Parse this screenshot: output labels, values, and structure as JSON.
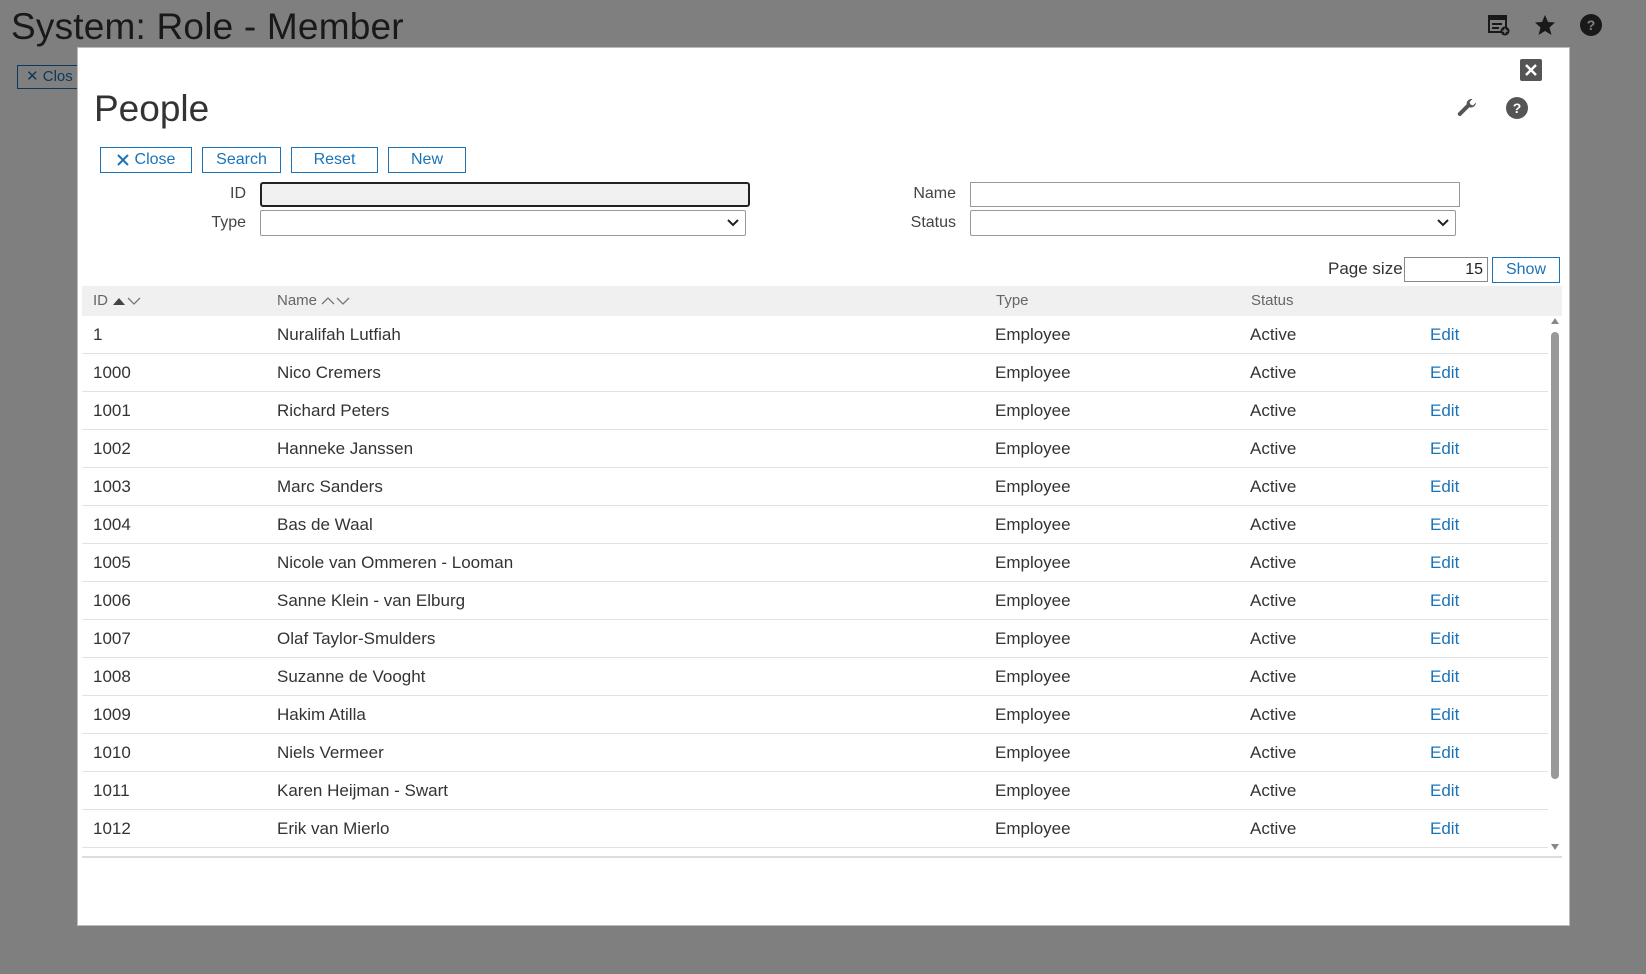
{
  "background": {
    "title": "System: Role - Member",
    "close_label": "Clos",
    "icons": [
      "report-icon",
      "star-icon",
      "help-icon"
    ]
  },
  "modal": {
    "title": "People",
    "icons": [
      "close-icon",
      "wrench-icon",
      "help-icon"
    ]
  },
  "toolbar": {
    "close_label": "Close",
    "search_label": "Search",
    "reset_label": "Reset",
    "new_label": "New"
  },
  "filters": {
    "id_label": "ID",
    "id_value": "",
    "type_label": "Type",
    "type_value": "",
    "name_label": "Name",
    "name_value": "",
    "status_label": "Status",
    "status_value": ""
  },
  "paging": {
    "page_size_label": "Page size",
    "page_size_value": "15",
    "show_label": "Show"
  },
  "table": {
    "columns": {
      "id": "ID",
      "name": "Name",
      "type": "Type",
      "status": "Status"
    },
    "sort": {
      "column": "ID",
      "direction": "ascending"
    },
    "edit_label": "Edit",
    "rows": [
      {
        "id": "1",
        "name": "Nuralifah Lutfiah",
        "type": "Employee",
        "status": "Active"
      },
      {
        "id": "1000",
        "name": "Nico Cremers",
        "type": "Employee",
        "status": "Active"
      },
      {
        "id": "1001",
        "name": "Richard Peters",
        "type": "Employee",
        "status": "Active"
      },
      {
        "id": "1002",
        "name": "Hanneke Janssen",
        "type": "Employee",
        "status": "Active"
      },
      {
        "id": "1003",
        "name": "Marc Sanders",
        "type": "Employee",
        "status": "Active"
      },
      {
        "id": "1004",
        "name": "Bas de Waal",
        "type": "Employee",
        "status": "Active"
      },
      {
        "id": "1005",
        "name": "Nicole van Ommeren - Looman",
        "type": "Employee",
        "status": "Active"
      },
      {
        "id": "1006",
        "name": "Sanne Klein - van Elburg",
        "type": "Employee",
        "status": "Active"
      },
      {
        "id": "1007",
        "name": "Olaf Taylor-Smulders",
        "type": "Employee",
        "status": "Active"
      },
      {
        "id": "1008",
        "name": "Suzanne de Vooght",
        "type": "Employee",
        "status": "Active"
      },
      {
        "id": "1009",
        "name": "Hakim Atilla",
        "type": "Employee",
        "status": "Active"
      },
      {
        "id": "1010",
        "name": "Niels Vermeer",
        "type": "Employee",
        "status": "Active"
      },
      {
        "id": "1011",
        "name": "Karen Heijman - Swart",
        "type": "Employee",
        "status": "Active"
      },
      {
        "id": "1012",
        "name": "Erik van Mierlo",
        "type": "Employee",
        "status": "Active"
      }
    ]
  },
  "colors": {
    "accent": "#1a73b8",
    "overlay": "rgba(0,0,0,0.5)",
    "header_bg": "#f0f0f0"
  }
}
